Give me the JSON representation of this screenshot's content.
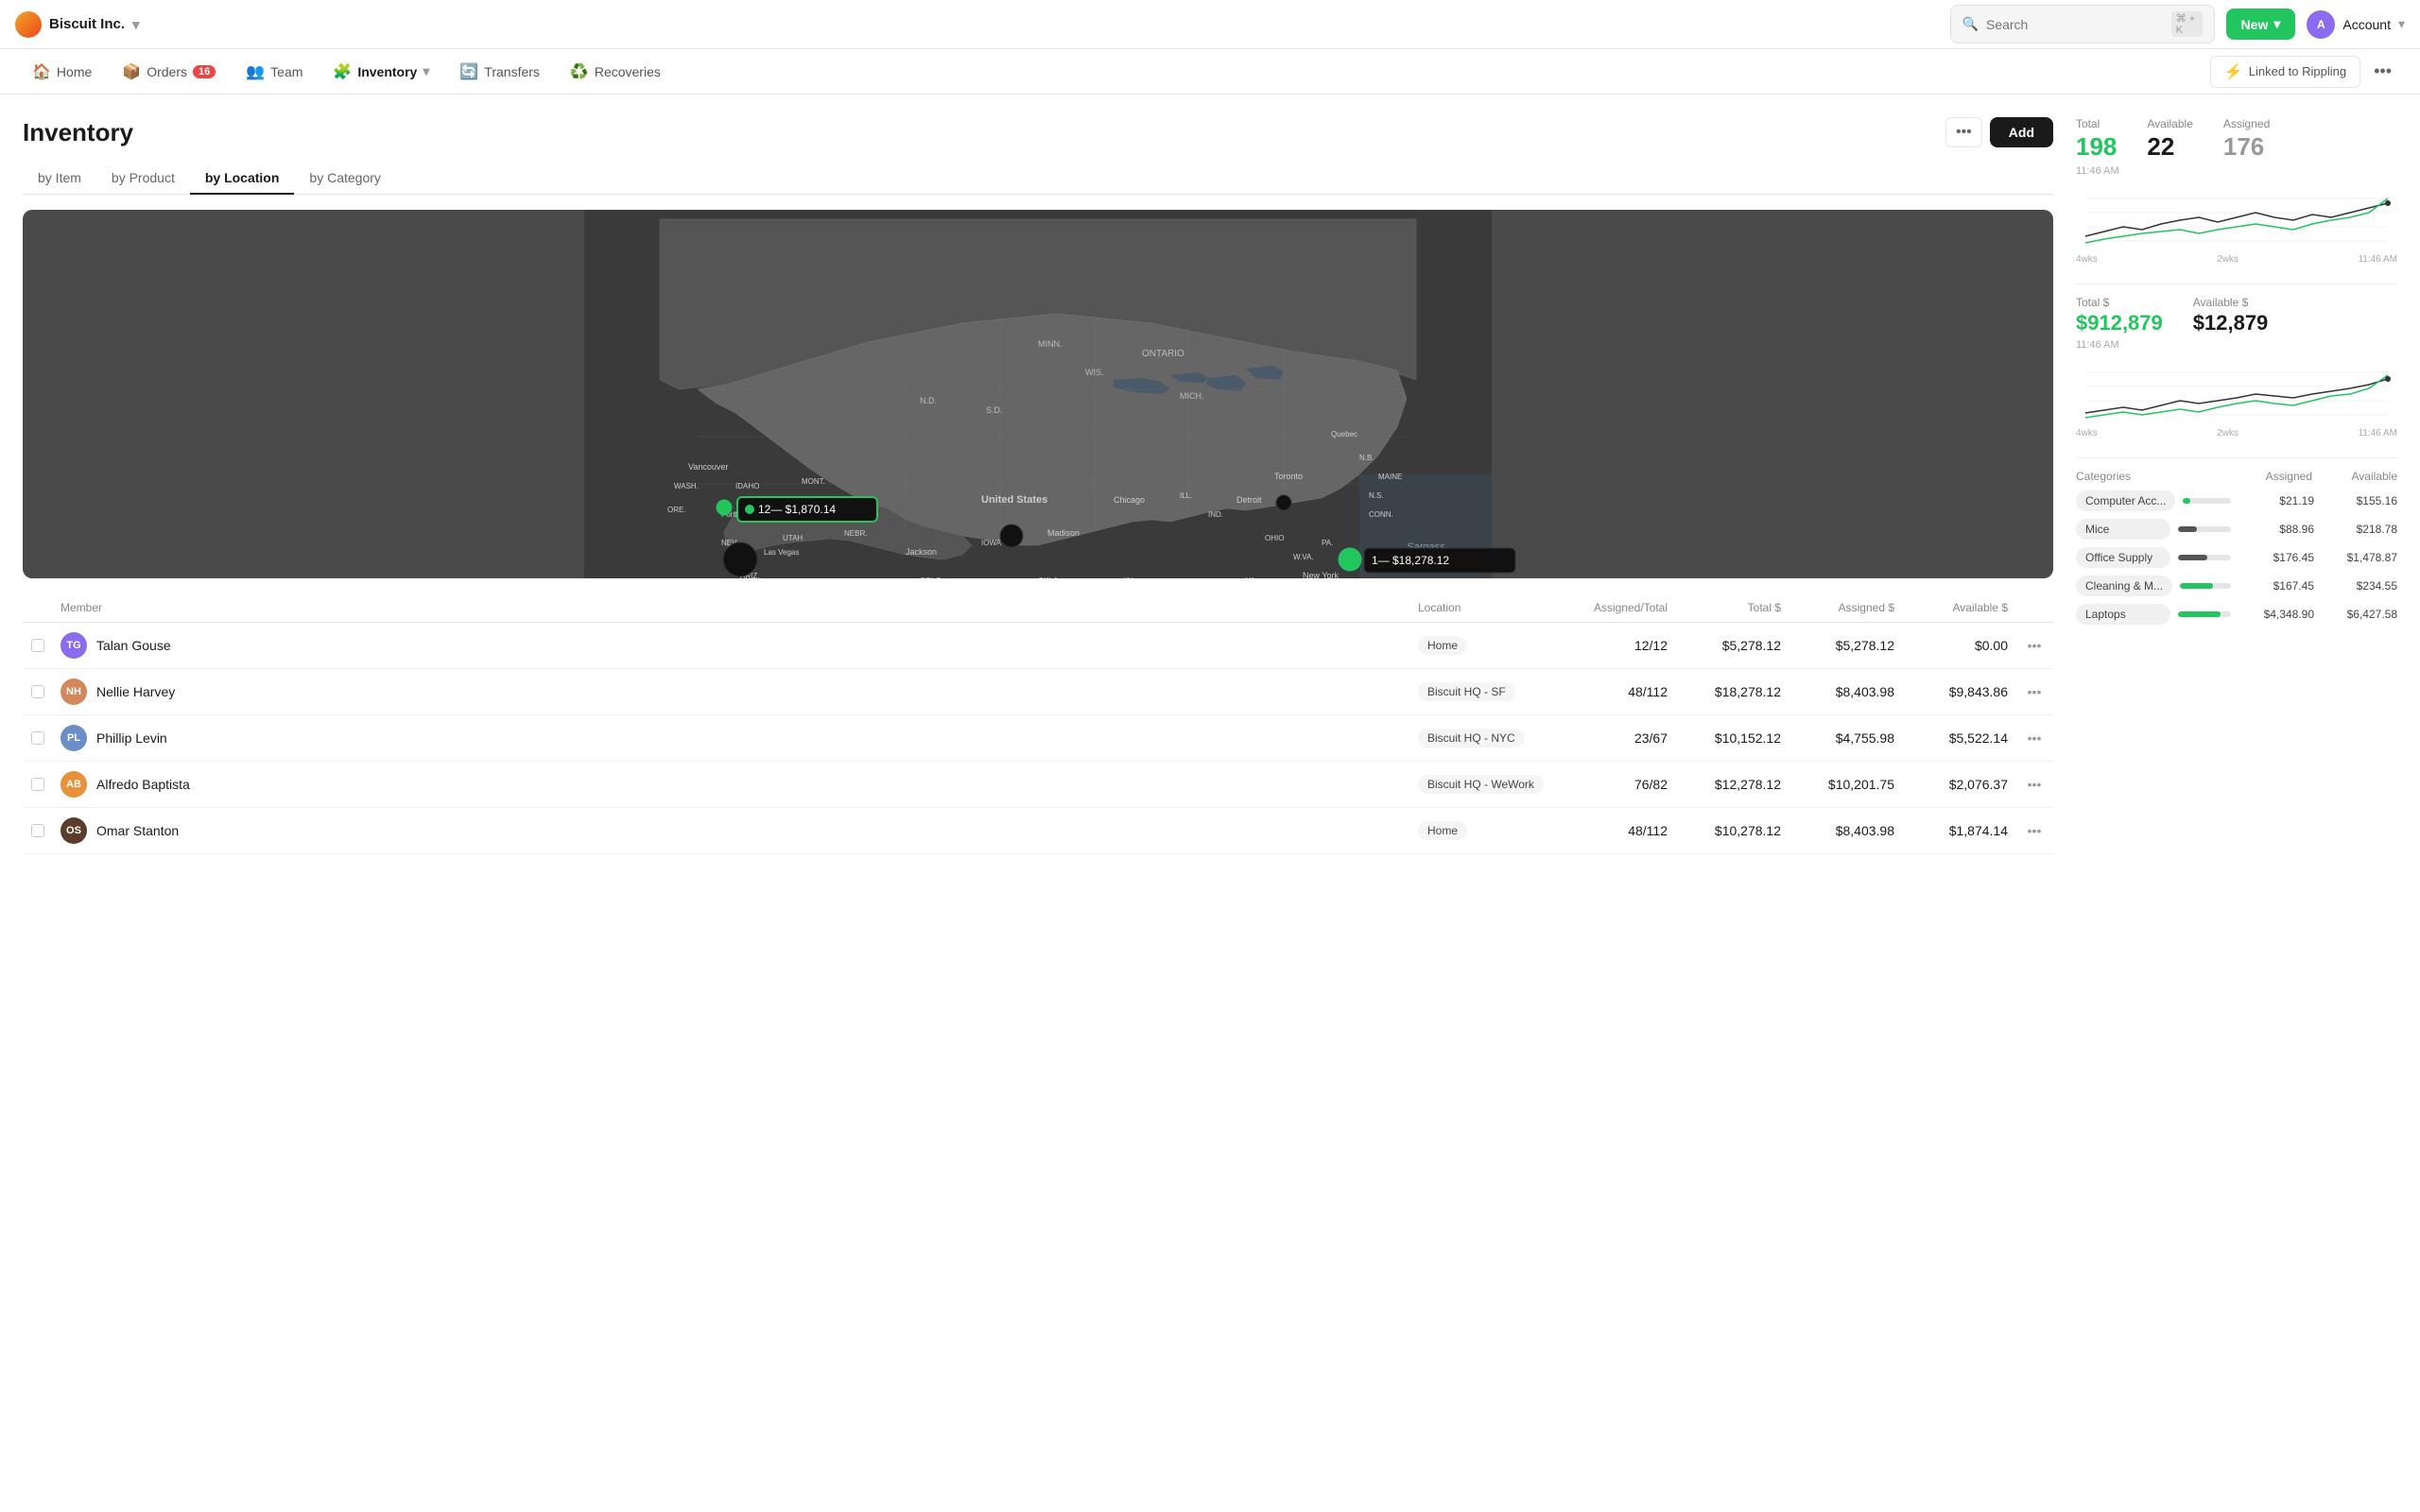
{
  "app": {
    "company": "Biscuit Inc.",
    "logo_emoji": "🍪"
  },
  "topbar": {
    "search_placeholder": "Search",
    "search_shortcut": "⌘ + K",
    "new_label": "New",
    "account_label": "Account"
  },
  "navbar": {
    "items": [
      {
        "id": "home",
        "label": "Home",
        "icon": "🏠",
        "active": false
      },
      {
        "id": "orders",
        "label": "Orders",
        "icon": "📦",
        "badge": "16",
        "active": false
      },
      {
        "id": "team",
        "label": "Team",
        "icon": "👥",
        "active": false
      },
      {
        "id": "inventory",
        "label": "Inventory",
        "icon": "🧩",
        "active": true
      },
      {
        "id": "transfers",
        "label": "Transfers",
        "icon": "🔄",
        "active": false
      },
      {
        "id": "recoveries",
        "label": "Recoveries",
        "icon": "♻️",
        "active": false
      }
    ],
    "linked_rippling": "Linked to Rippling",
    "more": "..."
  },
  "page": {
    "title": "Inventory",
    "tabs": [
      {
        "id": "by-item",
        "label": "by Item",
        "active": false
      },
      {
        "id": "by-product",
        "label": "by Product",
        "active": false
      },
      {
        "id": "by-location",
        "label": "by Location",
        "active": true
      },
      {
        "id": "by-category",
        "label": "by Category",
        "active": false
      }
    ],
    "add_label": "Add",
    "dots_label": "•••"
  },
  "map": {
    "label_portland": "12— $1,870.14",
    "label_nyc": "1— $18,278.12",
    "dot_la": true,
    "dot_central": true,
    "dot_southeast": true,
    "dot_midwest": true
  },
  "table": {
    "columns": [
      "",
      "Member",
      "Location",
      "Assigned/Total",
      "Total $",
      "Assigned $",
      "Available $",
      ""
    ],
    "rows": [
      {
        "name": "Talan Gouse",
        "location": "Home",
        "assigned_total": "12/12",
        "total": "$5,278.12",
        "assigned": "$5,278.12",
        "available": "$0.00",
        "avatar_color": "#8b6cef"
      },
      {
        "name": "Nellie Harvey",
        "location": "Biscuit HQ - SF",
        "assigned_total": "48/112",
        "total": "$18,278.12",
        "assigned": "$8,403.98",
        "available": "$9,843.86",
        "avatar_color": "#d4875a"
      },
      {
        "name": "Phillip Levin",
        "location": "Biscuit HQ - NYC",
        "assigned_total": "23/67",
        "total": "$10,152.12",
        "assigned": "$4,755.98",
        "available": "$5,522.14",
        "avatar_color": "#6b8ec7"
      },
      {
        "name": "Alfredo Baptista",
        "location": "Biscuit HQ - WeWork",
        "assigned_total": "76/82",
        "total": "$12,278.12",
        "assigned": "$10,201.75",
        "available": "$2,076.37",
        "avatar_color": "#e8903a"
      },
      {
        "name": "Omar Stanton",
        "location": "Home",
        "assigned_total": "48/112",
        "total": "$10,278.12",
        "assigned": "$8,403.98",
        "available": "$1,874.14",
        "avatar_color": "#5a3e2b"
      }
    ]
  },
  "stats": {
    "total_label": "Total",
    "available_label": "Available",
    "assigned_label": "Assigned",
    "total_value": "198",
    "available_value": "22",
    "assigned_value": "176",
    "time1": "11:46 AM",
    "chart1_time_labels": [
      "4wks",
      "2wks",
      "11:46 AM"
    ],
    "total_dollar_label": "Total $",
    "available_dollar_label": "Available $",
    "total_dollar_value": "$912,879",
    "available_dollar_value": "$12,879",
    "time2": "11:46 AM",
    "chart2_time_labels": [
      "4wks",
      "2wks",
      "11:46 AM"
    ]
  },
  "categories": {
    "header": [
      "Categories",
      "Assigned",
      "Available"
    ],
    "rows": [
      {
        "name": "Computer Acc...",
        "assigned": "$21.19",
        "available": "$155.16",
        "bar_pct": 15
      },
      {
        "name": "Mice",
        "assigned": "$88.96",
        "available": "$218.78",
        "bar_pct": 35
      },
      {
        "name": "Office Supply",
        "assigned": "$176.45",
        "available": "$1,478.87",
        "bar_pct": 55
      },
      {
        "name": "Cleaning & M...",
        "assigned": "$167.45",
        "available": "$234.55",
        "bar_pct": 65
      },
      {
        "name": "Laptops",
        "assigned": "$4,348.90",
        "available": "$6,427.58",
        "bar_pct": 80
      }
    ]
  }
}
